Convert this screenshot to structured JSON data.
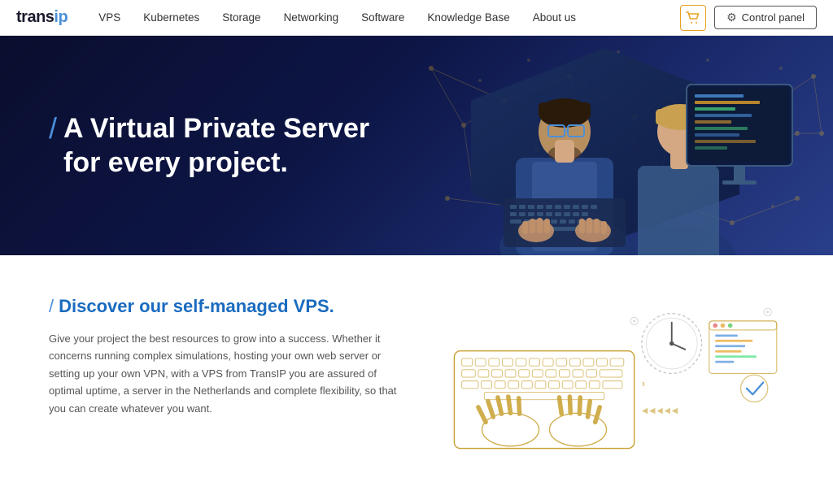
{
  "logo": {
    "trans": "trans",
    "ip": "ip"
  },
  "navbar": {
    "links": [
      {
        "id": "vps",
        "label": "VPS"
      },
      {
        "id": "kubernetes",
        "label": "Kubernetes"
      },
      {
        "id": "storage",
        "label": "Storage"
      },
      {
        "id": "networking",
        "label": "Networking"
      },
      {
        "id": "software",
        "label": "Software"
      },
      {
        "id": "knowledge-base",
        "label": "Knowledge Base"
      },
      {
        "id": "about-us",
        "label": "About us"
      }
    ],
    "cart_label": "🛒",
    "control_panel_label": "Control panel"
  },
  "hero": {
    "slash": "/",
    "title_line1": "A Virtual Private Server",
    "title_line2": "for every project."
  },
  "lower": {
    "slash": "/",
    "subtitle": "Discover our self-managed VPS.",
    "description": "Give your project the best resources to grow into a success. Whether it concerns running complex simulations, hosting your own web server or setting up your own VPN, with a VPS from TransIP you are assured of optimal uptime, a server in the Netherlands and complete flexibility, so that you can create whatever you want."
  }
}
